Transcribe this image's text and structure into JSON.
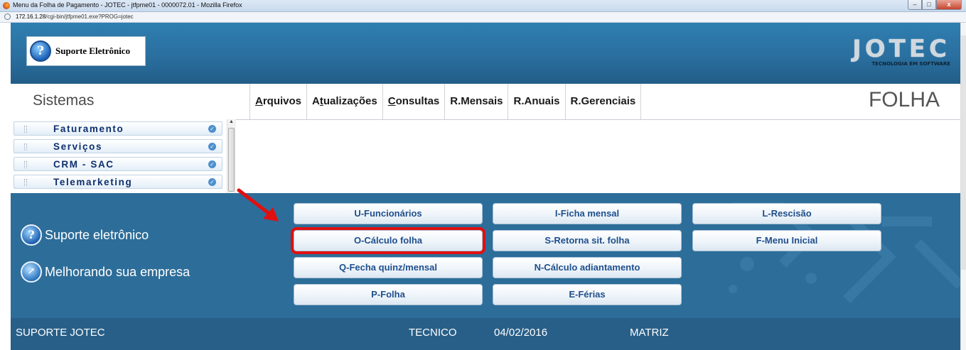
{
  "window": {
    "title": "Menu da Folha de Pagamento - JOTEC - jtfpme01 - 0000072.01 - Mozilla Firefox",
    "url_host": "172.16.1.28",
    "url_path": "/cgi-bin/jtfpme01.exe?PROG=jotec",
    "btn_close": "x"
  },
  "header": {
    "support_logo_text": "Suporte Eletrônico",
    "brand_word": "JOTEC",
    "brand_tagline": "TECNOLOGIA EM SOFTWARE"
  },
  "menubar": {
    "section": "Sistemas",
    "items": [
      {
        "accel": "A",
        "rest": "rquivos"
      },
      {
        "pre": "A",
        "accel": "t",
        "rest": "ualizações"
      },
      {
        "accel": "C",
        "rest": "onsultas"
      },
      {
        "label": "R.Mensais"
      },
      {
        "label": "R.Anuais"
      },
      {
        "label": "R.Gerenciais"
      }
    ],
    "module": "FOLHA"
  },
  "systems": [
    "Faturamento",
    "Serviços",
    "CRM - SAC",
    "Telemarketing"
  ],
  "side_links": {
    "support": "Suporte eletrônico",
    "improve": "Melhorando sua empresa"
  },
  "functions": {
    "u": "U-Funcionários",
    "i": "I-Ficha mensal",
    "l": "L-Rescisão",
    "o": "O-Cálculo folha",
    "s": "S-Retorna sit. folha",
    "f": "F-Menu Inicial",
    "q": "Q-Fecha quinz/mensal",
    "n": "N-Cálculo adiantamento",
    "p": "P-Folha",
    "e": "E-Férias"
  },
  "status": {
    "company": "SUPORTE JOTEC",
    "user": "TECNICO",
    "date": "04/02/2016",
    "branch": "MATRIZ"
  },
  "colors": {
    "panel_bg": "#2d6d99",
    "highlight": "#e01010",
    "button_text": "#1f4f8c"
  }
}
